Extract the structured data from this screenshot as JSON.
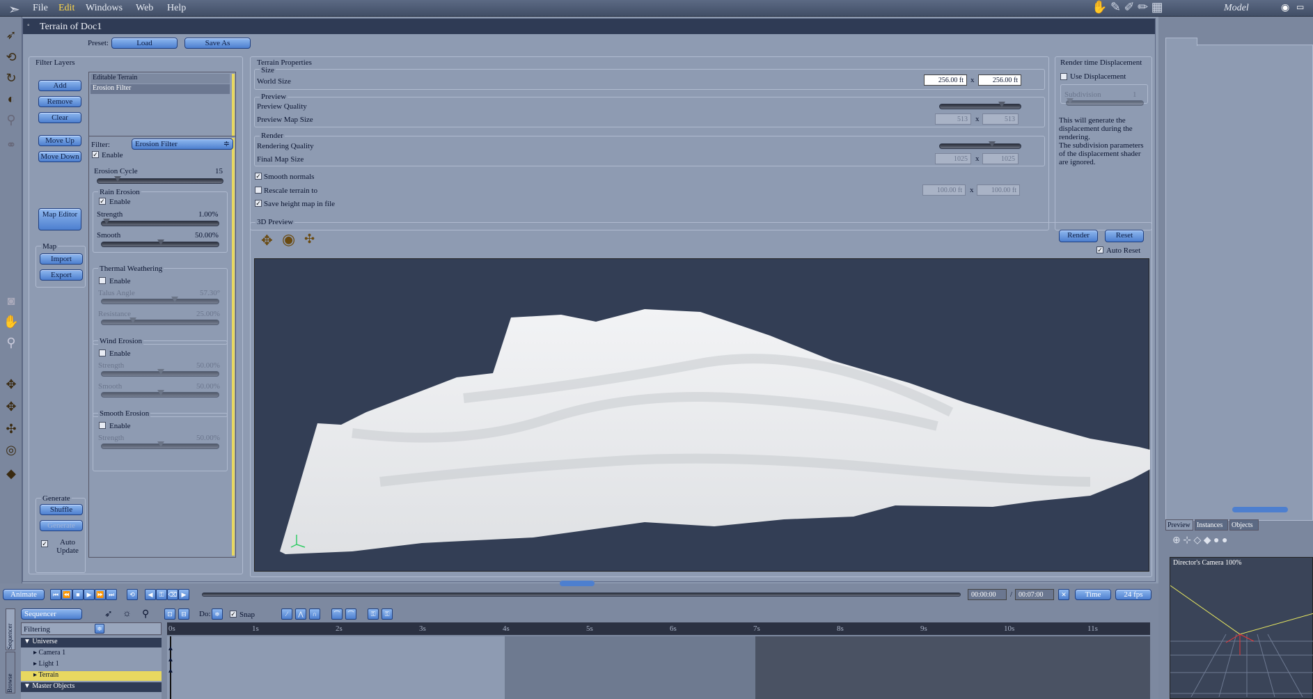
{
  "menubar": {
    "items": [
      "File",
      "Edit",
      "Windows",
      "Web",
      "Help"
    ],
    "mode": "Model"
  },
  "doc": {
    "title": "Terrain of Doc1",
    "preset_label": "Preset:",
    "load": "Load",
    "save_as": "Save As"
  },
  "filter_layers": {
    "title": "Filter Layers",
    "add": "Add",
    "remove": "Remove",
    "clear": "Clear",
    "move_up": "Move Up",
    "move_down": "Move Down",
    "map_editor": "Map Editor",
    "layers": [
      "Editable Terrain",
      "Erosion Filter"
    ],
    "map_title": "Map",
    "import": "Import",
    "export": "Export",
    "generate_title": "Generate",
    "shuffle": "Shuffle",
    "generate": "Generate",
    "auto_update": "Auto Update"
  },
  "filter": {
    "label": "Filter:",
    "value": "Erosion Filter",
    "enable": "Enable",
    "erosion_cycle": "Erosion Cycle",
    "erosion_cycle_val": "15",
    "rain": {
      "title": "Rain Erosion",
      "enable": "Enable",
      "strength": "Strength",
      "strength_val": "1.00%",
      "smooth": "Smooth",
      "smooth_val": "50.00%"
    },
    "thermal": {
      "title": "Thermal Weathering",
      "enable": "Enable",
      "talus": "Talus Angle",
      "talus_val": "57.30°",
      "resistance": "Resistance",
      "resistance_val": "25.00%"
    },
    "wind": {
      "title": "Wind Erosion",
      "enable": "Enable",
      "strength": "Strength",
      "strength_val": "50.00%",
      "smooth": "Smooth",
      "smooth_val": "50.00%"
    },
    "smooth": {
      "title": "Smooth Erosion",
      "enable": "Enable",
      "strength": "Strength",
      "strength_val": "50.00%"
    }
  },
  "terrain": {
    "title": "Terrain Properties",
    "size": "Size",
    "world_size": "World Size",
    "w1": "256.00 ft",
    "w2": "256.00 ft",
    "x": "x",
    "preview": "Preview",
    "preview_quality": "Preview Quality",
    "preview_map_size": "Preview Map Size",
    "pm1": "513",
    "pm2": "513",
    "render": "Render",
    "rendering_quality": "Rendering Quality",
    "final_map_size": "Final Map Size",
    "fm1": "1025",
    "fm2": "1025",
    "smooth_normals": "Smooth normals",
    "rescale": "Rescale terrain to",
    "r1": "100.00 ft",
    "r2": "100.00 ft",
    "save_height": "Save height map in file"
  },
  "displacement": {
    "title": "Render time Displacement",
    "use": "Use Displacement",
    "subdivision": "Subdivision",
    "subdivision_val": "1",
    "note1": "This will generate the displacement during the rendering.",
    "note2": "The subdivision parameters of the displacement shader are ignored."
  },
  "preview3d": {
    "title": "3D Preview",
    "render": "Render",
    "reset": "Reset",
    "auto_reset": "Auto Reset"
  },
  "timeline": {
    "animate": "Animate",
    "time1": "00:00:00",
    "time2": "00:07:00",
    "mode": "Time",
    "fps": "24 fps",
    "sequencer": "Sequencer",
    "do": "Do:",
    "snap": "Snap",
    "filtering": "Filtering",
    "ticks": [
      "0s",
      "1s",
      "2s",
      "3s",
      "4s",
      "5s",
      "6s",
      "7s",
      "8s",
      "9s",
      "10s",
      "11s"
    ],
    "tree": [
      "Universe",
      "Camera 1",
      "Light 1",
      "Terrain",
      "Master Objects"
    ],
    "side_tabs": [
      "Sequencer",
      "Browse"
    ]
  },
  "right": {
    "tabs": [
      "Preview",
      "Instances",
      "Objects"
    ],
    "camera": "Director's Camera 100%"
  }
}
